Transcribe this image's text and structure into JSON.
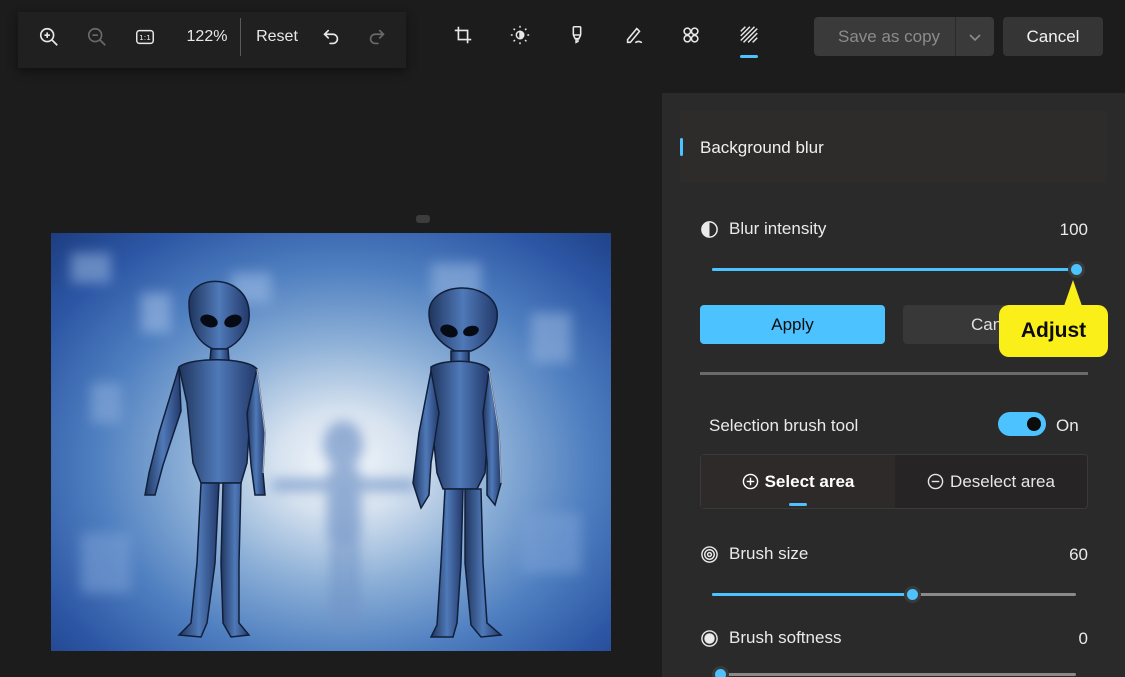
{
  "toolbar": {
    "zoom_level": "122%",
    "reset_label": "Reset",
    "icons": [
      "zoom-in-icon",
      "zoom-out-icon",
      "actual-size-icon",
      "undo-icon",
      "redo-icon"
    ],
    "tool_tabs": [
      "crop-icon",
      "brightness-icon",
      "marker-icon",
      "pen-icon",
      "filter-icon",
      "background-icon"
    ],
    "active_tab": "background-icon",
    "save_as_copy_label": "Save as copy",
    "cancel_label": "Cancel"
  },
  "panel": {
    "section_title": "Background blur",
    "blur_intensity": {
      "label": "Blur intensity",
      "value": "100",
      "fraction": 1.0
    },
    "apply_label": "Apply",
    "cancel_label": "Can",
    "selection_brush": {
      "label": "Selection brush tool",
      "state": "On"
    },
    "select_area_label": "Select area",
    "deselect_area_label": "Deselect area",
    "brush_size": {
      "label": "Brush size",
      "value": "60",
      "fraction": 0.55
    },
    "brush_softness": {
      "label": "Brush softness",
      "value": "0",
      "fraction": 0.0
    }
  },
  "callout": {
    "text": "Adjust"
  },
  "colors": {
    "accent": "#4cc2ff",
    "callout": "#fbef1a",
    "background": "#1c1c1c",
    "panel": "#2a2a2a"
  }
}
